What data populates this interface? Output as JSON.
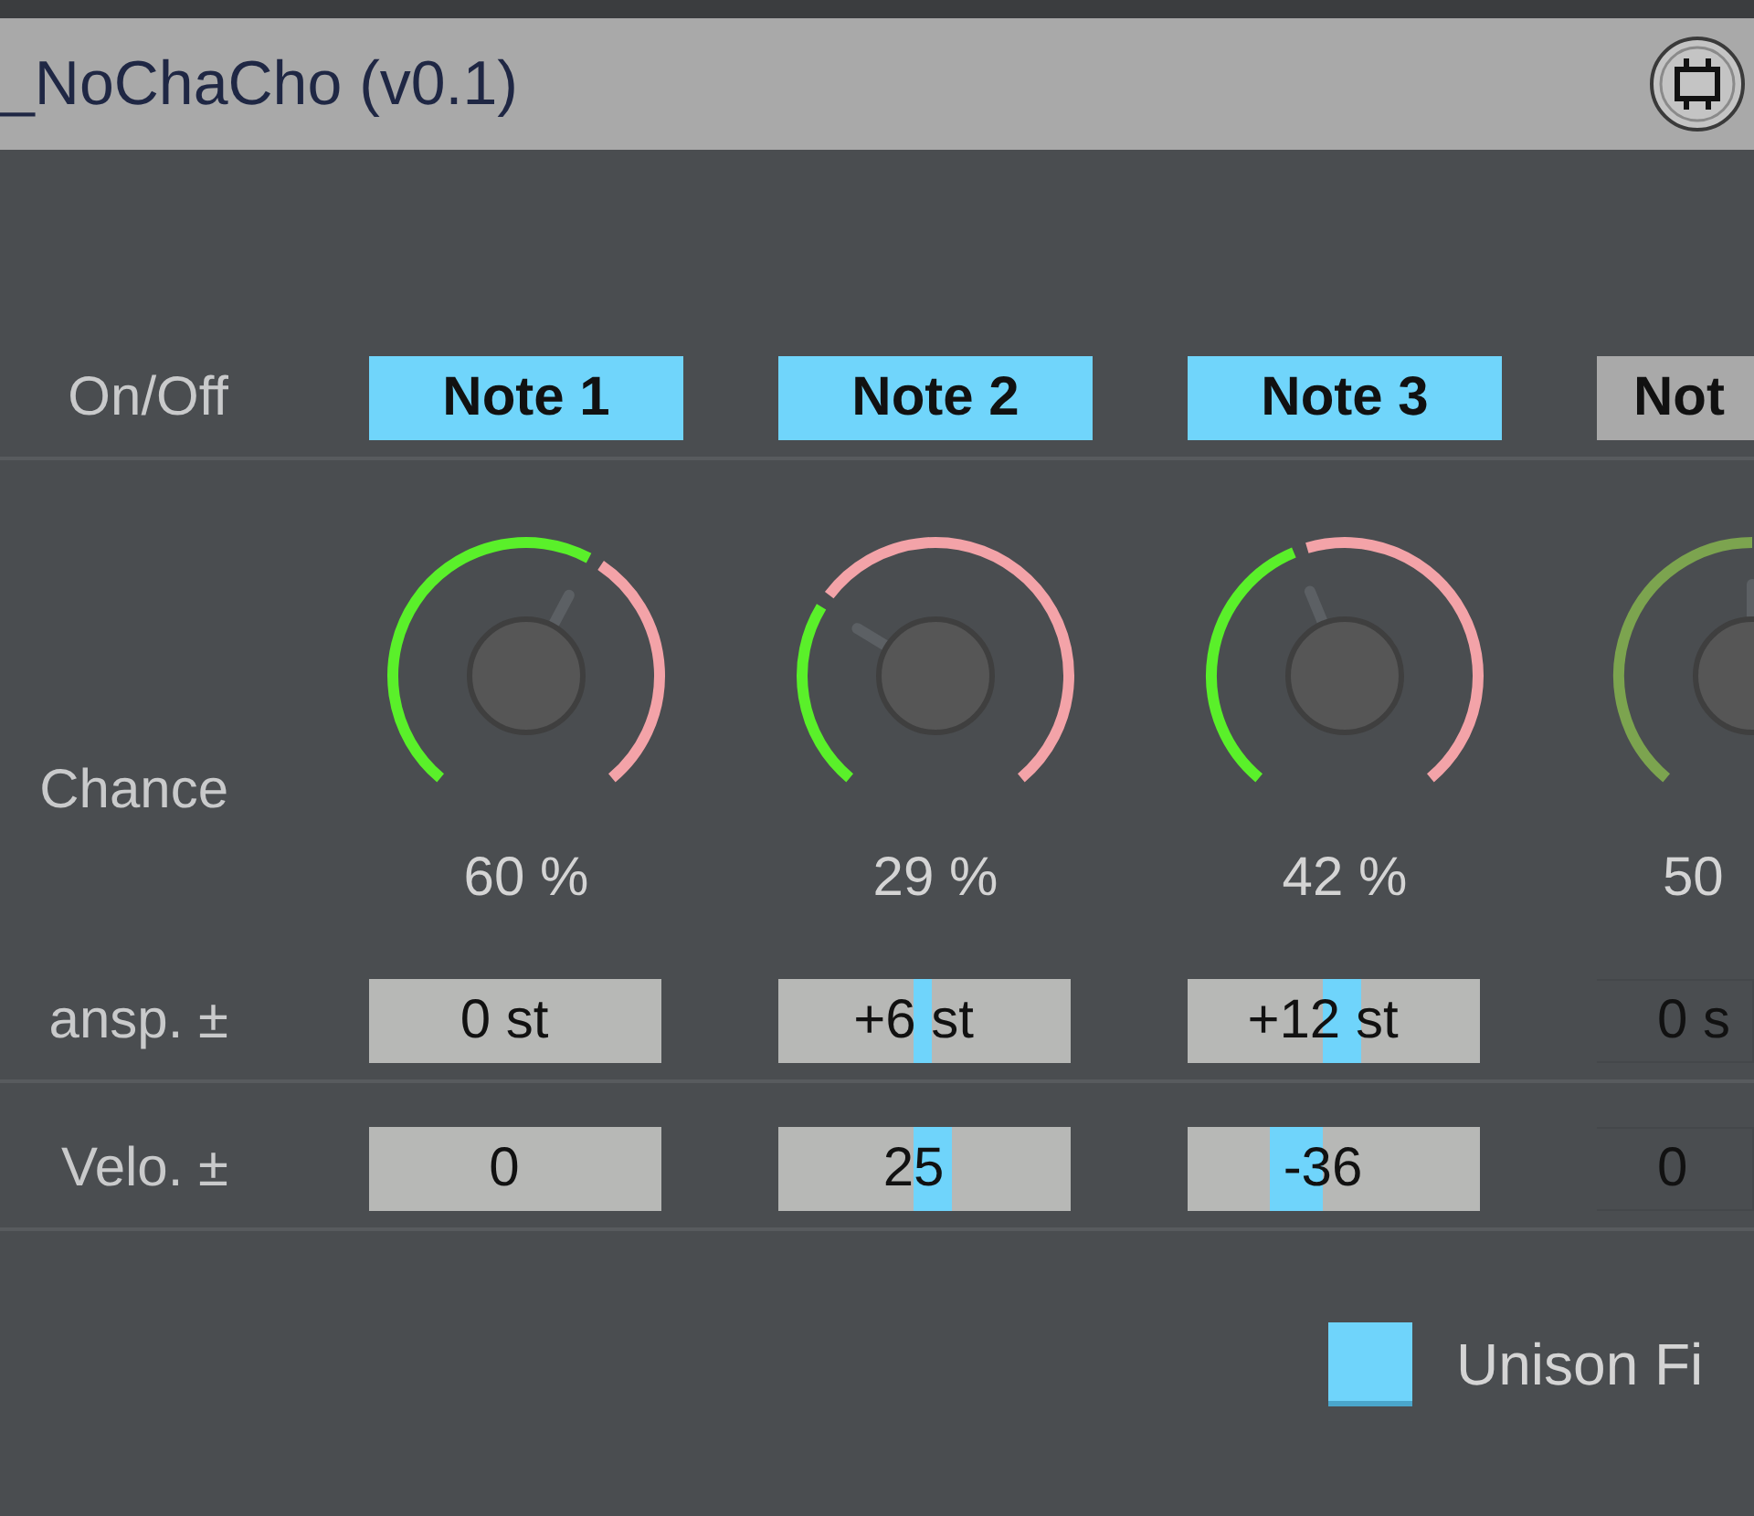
{
  "title": "_NoChaCho (v0.1)",
  "row_labels": {
    "on_off": "On/Off",
    "chance": "Chance",
    "transpose": "ansp. ±",
    "velocity": "Velo. ±"
  },
  "notes": [
    {
      "label": "Note 1",
      "on": true,
      "chance": {
        "reading": "60 %"
      },
      "transpose": {
        "value": "0 st"
      },
      "velocity": {
        "value": "0"
      }
    },
    {
      "label": "Note 2",
      "on": true,
      "chance": {
        "reading": "29 %"
      },
      "transpose": {
        "value": "+6 st"
      },
      "velocity": {
        "value": "25"
      }
    },
    {
      "label": "Note 3",
      "on": true,
      "chance": {
        "reading": "42 %"
      },
      "transpose": {
        "value": "+12 st"
      },
      "velocity": {
        "value": "-36"
      }
    },
    {
      "label": "Not",
      "on": false,
      "chance": {
        "reading": "50"
      },
      "transpose": {
        "value": "0 s"
      },
      "velocity": {
        "value": "0"
      }
    }
  ],
  "unison": {
    "label": "Unison Fi",
    "checked": true
  }
}
